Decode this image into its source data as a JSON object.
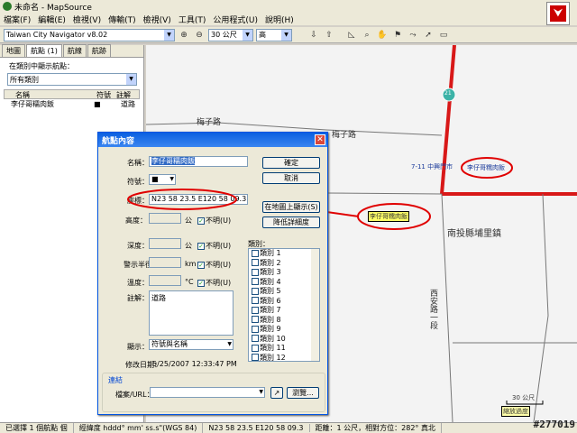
{
  "window": {
    "title": "未命名 - MapSource"
  },
  "menu": [
    "檔案(F)",
    "編輯(E)",
    "檢視(V)",
    "傳輸(T)",
    "檢視(V)",
    "工具(T)",
    "公用程式(U)",
    "說明(H)"
  ],
  "toolbar": {
    "product": "Taiwan City Navigator v8.02",
    "zoom": "30 公尺",
    "detail": "高"
  },
  "left": {
    "tabs": [
      "地圖",
      "航點 (1)",
      "航線",
      "航跡"
    ],
    "filter_label": "在類別中顯示航點：",
    "filter_value": "所有類別",
    "columns": [
      "名稱",
      "符號",
      "註解"
    ],
    "rows": [
      {
        "name": "李仔哥糯肉飯",
        "symbol": "■",
        "comment": "道路"
      }
    ]
  },
  "map": {
    "roads": [
      "梅子路",
      "梅子路",
      "西安路一段"
    ],
    "town": "南投縣埔里鎮",
    "poi_store": "7-11 中興門市",
    "poi_waypoint": "李仔哥糯肉飯",
    "poi_selected": "李仔哥糯肉飯",
    "route_shield": "21",
    "scale": "30 公尺",
    "overzoom": "縮放過度"
  },
  "dialog": {
    "title": "航點內容",
    "name_label": "名稱：",
    "name_value": "李仔哥糯肉飯",
    "symbol_label": "符號：",
    "symbol_value": "■",
    "position_label": "座標：",
    "position_value": "N23 58 23.5 E120 58 09.3",
    "altitude_label": "高度：",
    "altitude_unit": "公",
    "unknown": "不明(U)",
    "depth_label": "深度：",
    "depth_unit": "公",
    "proximity_label": "警示半徑：",
    "proximity_unit": "km",
    "temp_label": "溫度：",
    "temp_unit": "°C",
    "comment_label": "註解：",
    "comment_value": "道路",
    "display_label": "顯示：",
    "display_value": "符號與名稱",
    "modified_label": "修改日期：",
    "modified_value": "5/25/2007 12:33:47 PM",
    "links_label": "連結",
    "file_label": "檔案/URL：",
    "categories_label": "類別：",
    "categories": [
      "類別 1",
      "類別 2",
      "類別 3",
      "類別 4",
      "類別 5",
      "類別 6",
      "類別 7",
      "類別 8",
      "類別 9",
      "類別 10",
      "類別 11",
      "類別 12"
    ],
    "ok": "確定",
    "cancel": "取消",
    "show_on_map": "在地圖上顯示(S)",
    "weather": "降低詳細度",
    "browse": "瀏覽..."
  },
  "status": {
    "selected": "已選擇 1 個航點 個",
    "format": "經緯度 hddd° mm' ss.s\"(WGS 84)",
    "coords": "N23 58 23.5 E120 58 09.3",
    "distance": "距離：1 公尺，相對方位：282° 真北"
  },
  "watermark": "#277019",
  "colors": {
    "accent": "#0a5fe0",
    "road": "#d81818",
    "highlight": "#e00000"
  }
}
